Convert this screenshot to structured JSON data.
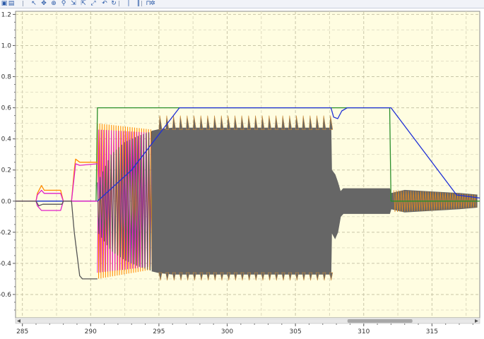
{
  "toolbar": {
    "buttons": [
      {
        "name": "open-icon",
        "glyph": "▣"
      },
      {
        "name": "save-icon",
        "glyph": "▤"
      },
      {
        "name": "pointer-icon",
        "glyph": "↖"
      },
      {
        "name": "pan-icon",
        "glyph": "✥"
      },
      {
        "name": "zoom-box-icon",
        "glyph": "⊕"
      },
      {
        "name": "zoom-icon",
        "glyph": "⚲"
      },
      {
        "name": "zoom-x-icon",
        "glyph": "⇲"
      },
      {
        "name": "zoom-y-icon",
        "glyph": "⇱"
      },
      {
        "name": "zoom-fit-icon",
        "glyph": "⤢"
      },
      {
        "name": "undo-icon",
        "glyph": "↶"
      },
      {
        "name": "redo-icon",
        "glyph": "↻"
      },
      {
        "name": "cursor-icon",
        "glyph": "∣"
      },
      {
        "name": "cursors-pair-icon",
        "glyph": "‖"
      },
      {
        "name": "measure-icon",
        "glyph": "⊓"
      },
      {
        "name": "settings-icon",
        "glyph": "✲"
      }
    ]
  },
  "chart_data": {
    "type": "line",
    "title": "",
    "xlabel": "",
    "ylabel": "",
    "xlim": [
      284.5,
      318.5
    ],
    "ylim": [
      -0.75,
      1.22
    ],
    "xticks": [
      "285",
      "290",
      "295",
      "300",
      "305",
      "310",
      "315"
    ],
    "xtick_values": [
      285,
      290,
      295,
      300,
      305,
      310,
      315
    ],
    "yticks": [
      "1.2",
      "1.0",
      "0.8",
      "0.6",
      "0.4",
      "0.2",
      "0.0",
      "-0.2",
      "-0.4",
      "-0.6"
    ],
    "ytick_values": [
      1.2,
      1.0,
      0.8,
      0.6,
      0.4,
      0.2,
      0.0,
      -0.2,
      -0.4,
      -0.6
    ],
    "grid": true,
    "legend": "none",
    "background": "#fffde1",
    "scrollbar": {
      "visible_start": 284.5,
      "visible_end": 318.5,
      "thumb_start": 0.715,
      "thumb_end": 0.855
    },
    "series": [
      {
        "color": "#2a8f2a",
        "x": [
          284.5,
          290.4,
          290.5,
          311.9,
          312.0,
          318.5
        ],
        "y": [
          0.0,
          0.0,
          0.6,
          0.6,
          0.0,
          0.0
        ]
      },
      {
        "color": "#1f2fd6",
        "x": [
          284.5,
          286.8,
          287.2,
          288.6,
          289.0,
          290.5,
          291.0,
          293.0,
          296.5,
          307.6,
          307.8,
          308.1,
          308.4,
          308.8,
          312.0,
          316.8,
          318.5
        ],
        "y": [
          0.0,
          0.0,
          0.0,
          0.0,
          0.0,
          0.0,
          0.04,
          0.2,
          0.6,
          0.6,
          0.54,
          0.53,
          0.58,
          0.6,
          0.6,
          0.04,
          0.02
        ]
      },
      {
        "color": "#ff8c00",
        "x": [
          284.5,
          286.0,
          286.1,
          286.4,
          286.6,
          287.8,
          288.0,
          288.6,
          288.8,
          288.9,
          289.2,
          290.5
        ],
        "y": [
          0.0,
          0.0,
          0.05,
          0.1,
          0.07,
          0.07,
          0.0,
          0.0,
          0.2,
          0.27,
          0.25,
          0.25
        ]
      },
      {
        "color": "#e020c8",
        "x": [
          284.5,
          286.0,
          286.1,
          286.4,
          286.6,
          287.8,
          288.0,
          288.6,
          288.8,
          288.9,
          289.2,
          290.5
        ],
        "y": [
          0.0,
          0.0,
          0.04,
          0.07,
          0.05,
          0.05,
          0.0,
          0.0,
          0.16,
          0.24,
          0.23,
          0.24
        ]
      },
      {
        "color": "#e020c8",
        "x": [
          284.5,
          286.0,
          286.1,
          286.4,
          287.8,
          288.0,
          290.5
        ],
        "y": [
          0.0,
          0.0,
          -0.03,
          -0.06,
          -0.06,
          0.0,
          0.0
        ]
      },
      {
        "color": "#555555",
        "x": [
          284.5,
          286.0,
          286.2,
          286.5,
          287.9,
          288.0,
          288.6,
          288.8,
          289.2,
          289.4,
          290.2,
          290.5
        ],
        "y": [
          0.0,
          0.0,
          -0.03,
          -0.02,
          -0.02,
          0.0,
          0.0,
          -0.2,
          -0.48,
          -0.5,
          -0.5,
          -0.5
        ]
      }
    ],
    "oscillation_envelopes": [
      {
        "color": "#ff8c00",
        "x": [
          290.5,
          294.5
        ],
        "upper": [
          0.5,
          0.46
        ],
        "lower": [
          -0.5,
          -0.44
        ]
      },
      {
        "color": "#e020c8",
        "x": [
          290.5,
          294.5
        ],
        "upper": [
          0.46,
          0.44
        ],
        "lower": [
          -0.46,
          -0.42
        ]
      },
      {
        "color": "#555555",
        "x": [
          290.5,
          291.5,
          292.5,
          293.5,
          294.5
        ],
        "upper": [
          0.12,
          0.3,
          0.38,
          0.42,
          0.45
        ],
        "lower": [
          -0.2,
          -0.32,
          -0.38,
          -0.42,
          -0.45
        ]
      }
    ],
    "dense_band": {
      "color": "#666666",
      "x": [
        294.5,
        295.0,
        296.0,
        298.0,
        300.0,
        302.0,
        304.0,
        306.0,
        307.6,
        307.65,
        307.9,
        308.1,
        308.3,
        308.5,
        311.9,
        312.0,
        313.0,
        315.0,
        317.0,
        318.3
      ],
      "upper": [
        0.45,
        0.46,
        0.47,
        0.47,
        0.47,
        0.47,
        0.47,
        0.47,
        0.47,
        0.2,
        0.17,
        0.12,
        0.06,
        0.08,
        0.08,
        0.05,
        0.07,
        0.06,
        0.05,
        0.04
      ],
      "lower": [
        -0.45,
        -0.46,
        -0.47,
        -0.47,
        -0.47,
        -0.47,
        -0.47,
        -0.47,
        -0.47,
        -0.2,
        -0.24,
        -0.2,
        -0.1,
        -0.08,
        -0.08,
        -0.05,
        -0.07,
        -0.06,
        -0.05,
        -0.04
      ]
    },
    "band_spikes": {
      "x_start": 295.0,
      "x_end": 307.5,
      "spacing": 0.5,
      "top": 0.55,
      "bottom": -0.51
    }
  }
}
